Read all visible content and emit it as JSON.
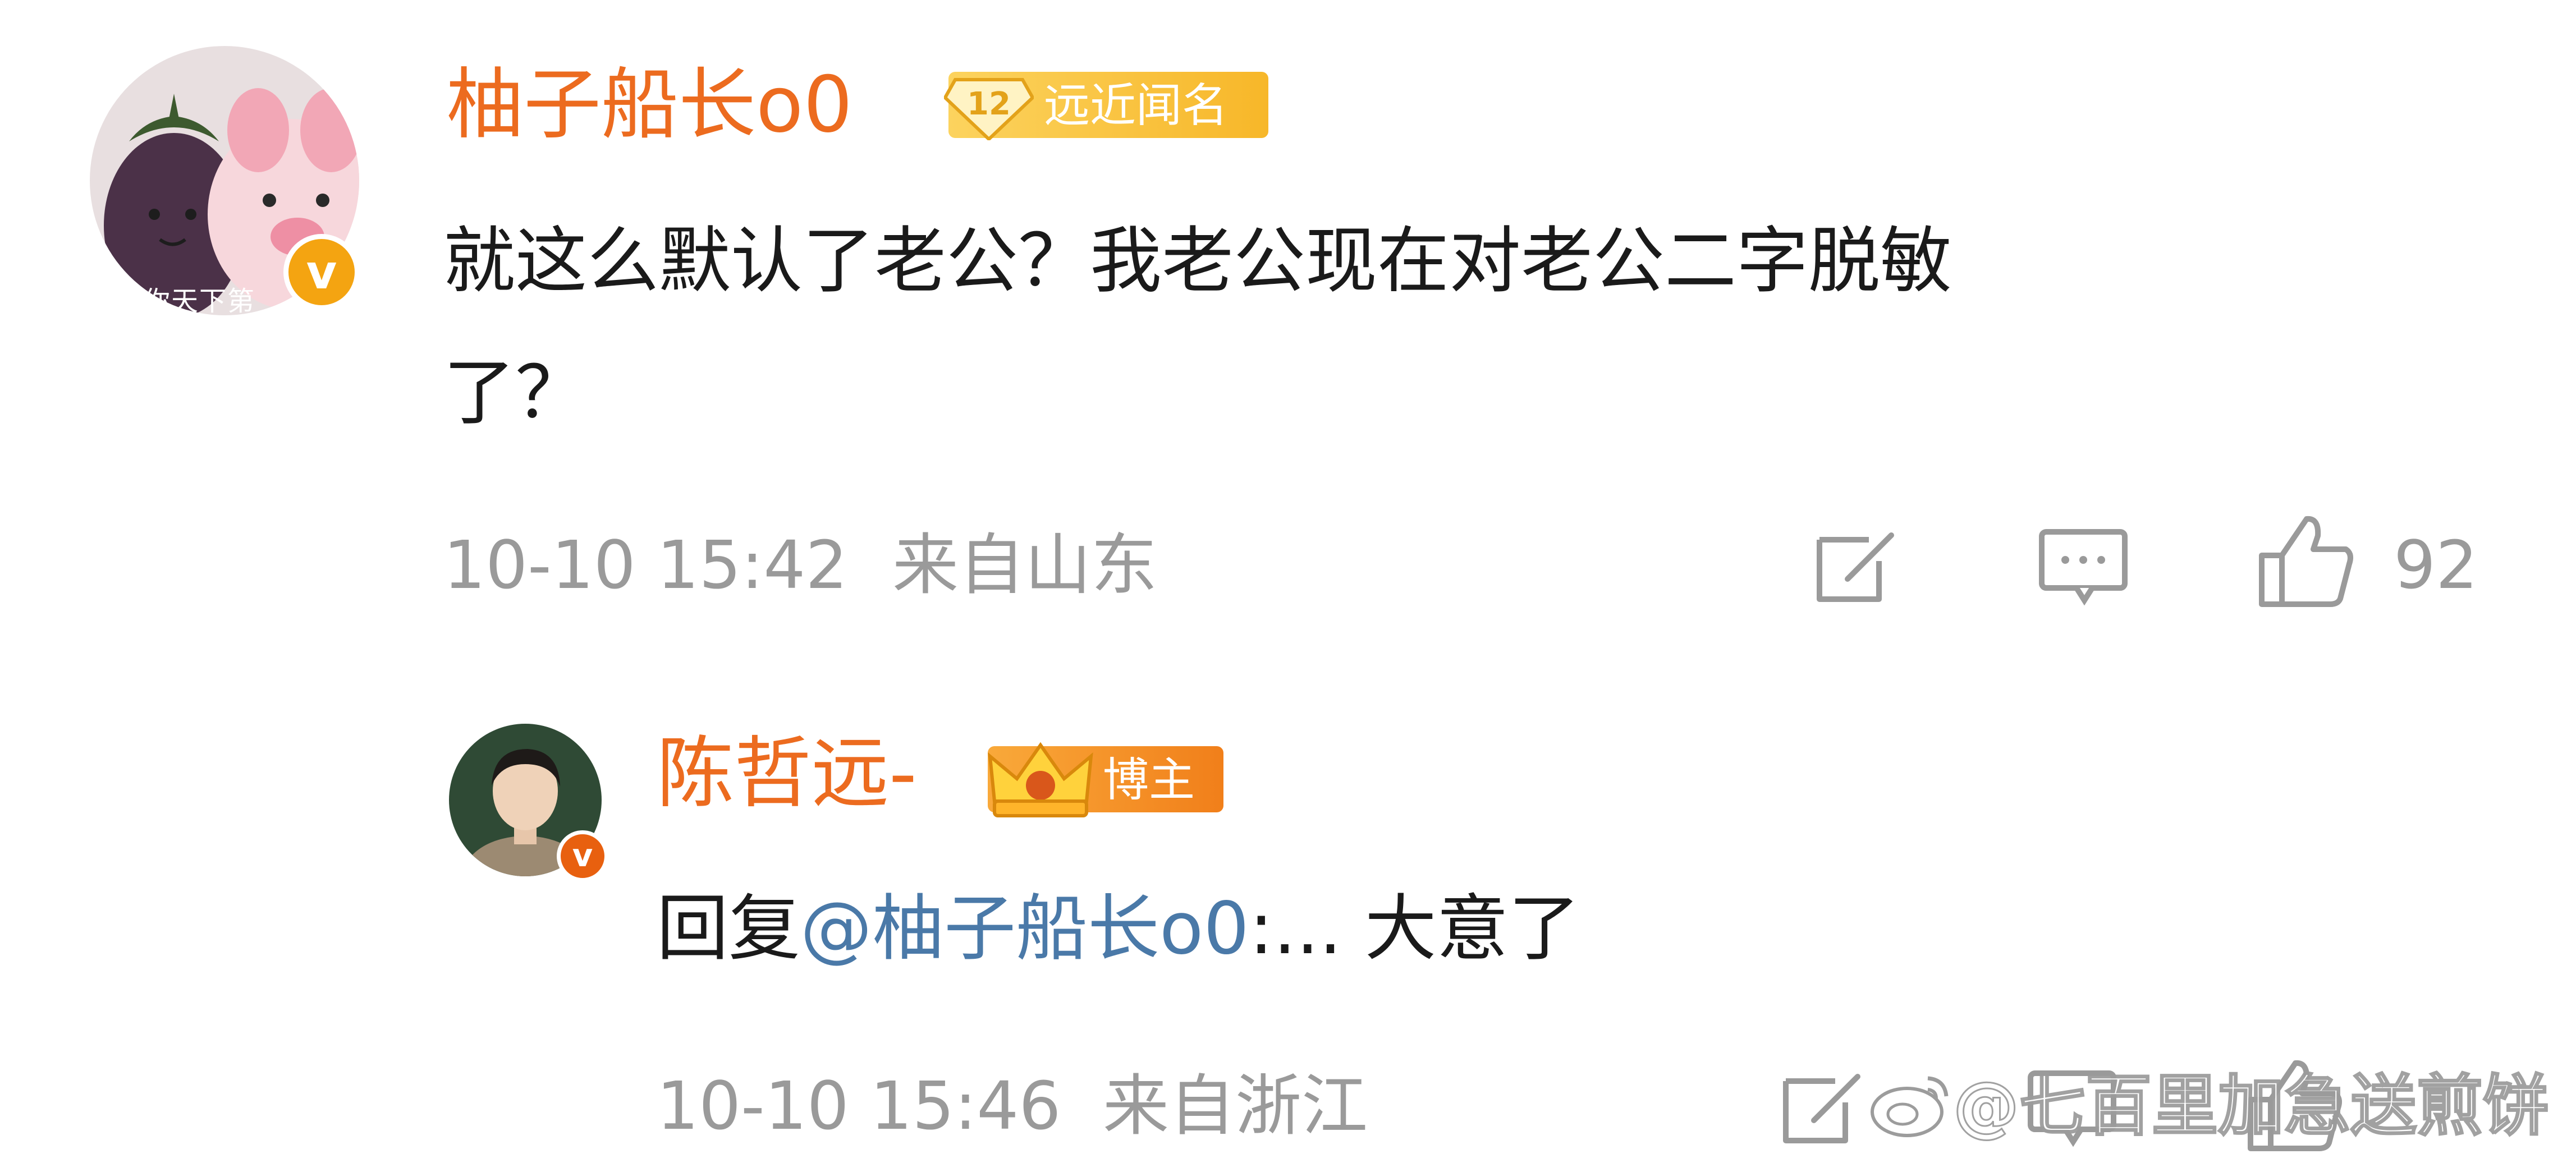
{
  "comment": {
    "username": "柚子船长o0",
    "fan_badge": {
      "level": "12",
      "label": "远近闻名"
    },
    "text_line1": "就这么默认了老公？我老公现在对老公二字脱敏",
    "text_line2": "了？",
    "avatar_caption": "你天下第",
    "date": "10-10 15:42",
    "location": "来自山东",
    "likes": "92"
  },
  "reply": {
    "username": "陈哲远-",
    "badge_label": "博主",
    "reply_prefix": "回复",
    "mention": "@柚子船长o0",
    "reply_text": ":... 大意了",
    "date": "10-10 15:46",
    "location": "来自浙江"
  },
  "watermark": "@七百里加急送煎饼",
  "colors": {
    "username": "#ec6b1f",
    "mention": "#4a79a8",
    "meta_gray": "#9a9a9a",
    "badge_gold": "#f7b729",
    "verified": "#f4a411"
  },
  "icons": [
    "repost-icon",
    "comment-icon",
    "like-icon",
    "weibo-logo-icon",
    "crown-icon",
    "diamond-level-icon",
    "verified-v-icon"
  ]
}
